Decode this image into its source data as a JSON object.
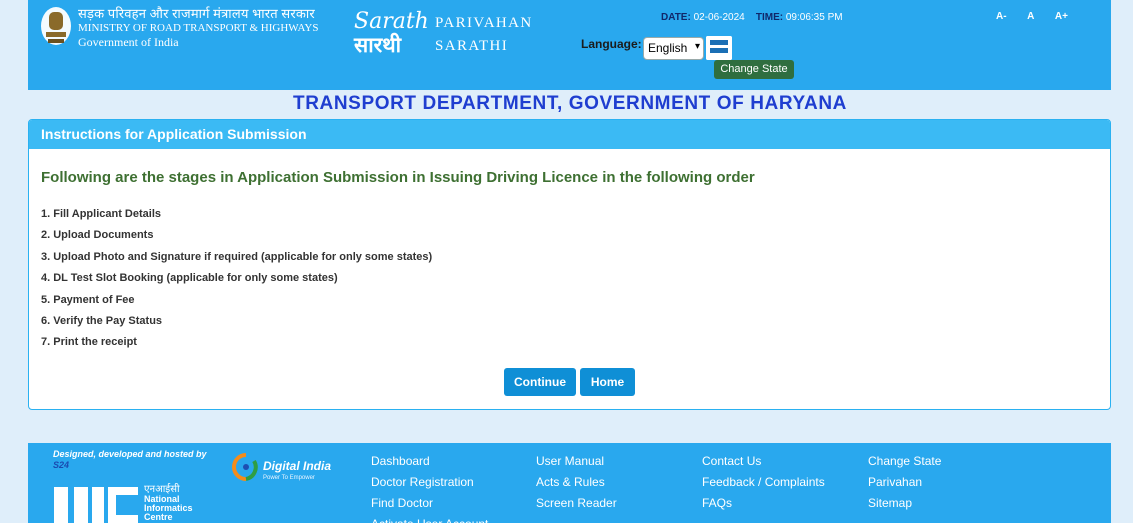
{
  "header": {
    "ministry_hindi": "सड़क परिवहन और राजमार्ग मंत्रालय भारत सरकार",
    "ministry_english": "MINISTRY OF ROAD TRANSPORT & HIGHWAYS",
    "government": "Government of India",
    "logo_text_en": "Sarathi",
    "logo_text_hi": "सारथी",
    "parivahan": "PARIVAHAN",
    "sarathi": "SARATHI",
    "date_label": "DATE:",
    "date_value": "02-06-2024",
    "time_label": "TIME:",
    "time_value": "09:06:35 PM",
    "font_small": "A-",
    "font_normal": "A",
    "font_large": "A+",
    "language_label": "Language:",
    "language_value": "English",
    "change_state": "Change State"
  },
  "department_title": "TRANSPORT DEPARTMENT, GOVERNMENT OF HARYANA",
  "panel": {
    "heading": "Instructions for Application Submission",
    "subheading": "Following are the stages in Application Submission in Issuing Driving Licence in the following order",
    "steps": [
      "1. Fill Applicant Details",
      "2. Upload Documents",
      "3. Upload Photo and Signature if required (applicable for only some states)",
      "4. DL Test Slot Booking (applicable for only some states)",
      "5. Payment of Fee",
      "6. Verify the Pay Status",
      "7. Print the receipt"
    ],
    "continue_label": "Continue",
    "home_label": "Home"
  },
  "footer": {
    "designed_by": "Designed, developed and hosted by",
    "designed_sub": "S24",
    "nic_hindi": "एनआईसी",
    "nic_english_1": "National",
    "nic_english_2": "Informatics",
    "nic_english_3": "Centre",
    "digital_india": "Digital India",
    "digital_india_tag": "Power To Empower",
    "col1": [
      "Dashboard",
      "Doctor Registration",
      "Find Doctor",
      "Activate User Account"
    ],
    "col2": [
      "User Manual",
      "Acts & Rules",
      "Screen Reader"
    ],
    "col3": [
      "Contact Us",
      "Feedback / Complaints",
      "FAQs"
    ],
    "col4": [
      "Change State",
      "Parivahan",
      "Sitemap"
    ]
  },
  "colors": {
    "header_blue": "#29a8ee",
    "title_blue": "#1f3ed0",
    "subheading_green": "#3e7032",
    "button_blue": "#0f8fd6",
    "change_state_green": "#2f6e3f"
  }
}
